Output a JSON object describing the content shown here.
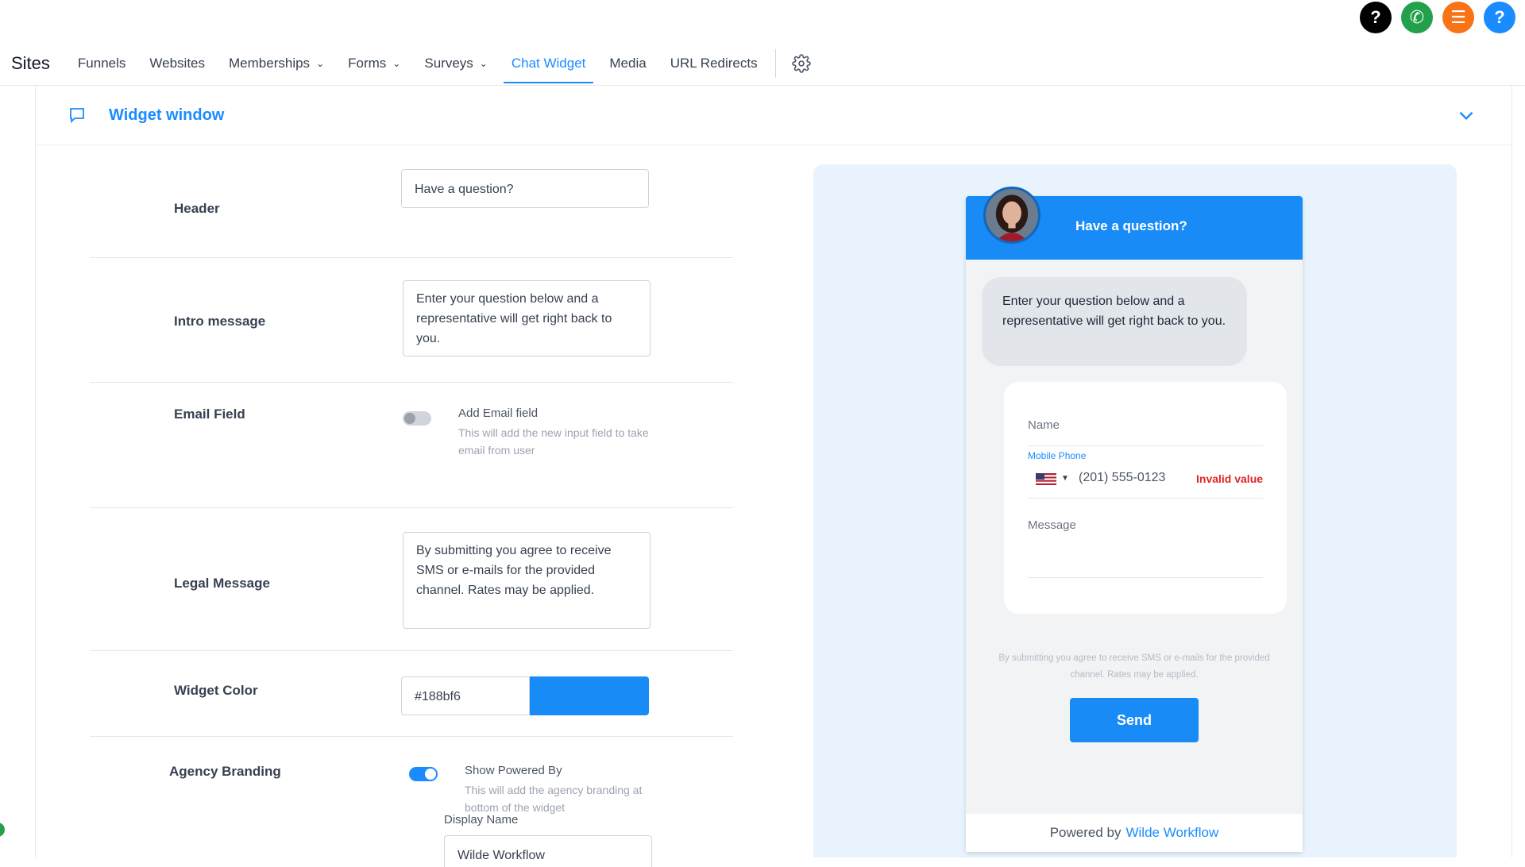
{
  "top_icons": [
    {
      "name": "help-icon",
      "glyph": "?",
      "color": "#000000"
    },
    {
      "name": "phone-icon",
      "glyph": "✆",
      "color": "#22a04b"
    },
    {
      "name": "list-icon",
      "glyph": "☰",
      "color": "#f97316"
    },
    {
      "name": "help-blue-icon",
      "glyph": "?",
      "color": "#1a8cff"
    }
  ],
  "nav": {
    "sites": "Sites",
    "items": [
      {
        "label": "Funnels",
        "dropdown": false
      },
      {
        "label": "Websites",
        "dropdown": false
      },
      {
        "label": "Memberships",
        "dropdown": true
      },
      {
        "label": "Forms",
        "dropdown": true
      },
      {
        "label": "Surveys",
        "dropdown": true
      },
      {
        "label": "Chat Widget",
        "dropdown": false,
        "active": true
      },
      {
        "label": "Media",
        "dropdown": false
      },
      {
        "label": "URL Redirects",
        "dropdown": false
      }
    ]
  },
  "section": {
    "title": "Widget window"
  },
  "form": {
    "header_label": "Header",
    "header_value": "Have a question?",
    "intro_label": "Intro message",
    "intro_value": "Enter your question below and a representative will get right back to you.",
    "email_label": "Email Field",
    "email_toggle_title": "Add Email field",
    "email_toggle_desc": "This will add the new input field to take email from user",
    "email_toggle_on": false,
    "legal_label": "Legal Message",
    "legal_value": "By submitting you agree to receive SMS or e-mails for the provided channel. Rates may be applied.",
    "color_label": "Widget Color",
    "color_value": "#188bf6",
    "branding_label": "Agency Branding",
    "branding_toggle_title": "Show Powered By",
    "branding_toggle_desc": "This will add the agency branding at bottom of the widget",
    "branding_toggle_on": true,
    "display_name_label": "Display Name",
    "display_name_value": "Wilde Workflow"
  },
  "preview": {
    "header": "Have a question?",
    "intro": "Enter your question below and a representative will get right back to you.",
    "name_placeholder": "Name",
    "phone_label": "Mobile Phone",
    "phone_value": "(201) 555-0123",
    "phone_error": "Invalid value",
    "message_placeholder": "Message",
    "legal": "By submitting you agree to receive SMS or e-mails for the provided channel. Rates may be applied.",
    "send": "Send",
    "powered_prefix": "Powered by",
    "powered_brand": "Wilde Workflow"
  },
  "colors": {
    "accent": "#1a8cff",
    "widget": "#188bf6",
    "error": "#e02424"
  }
}
